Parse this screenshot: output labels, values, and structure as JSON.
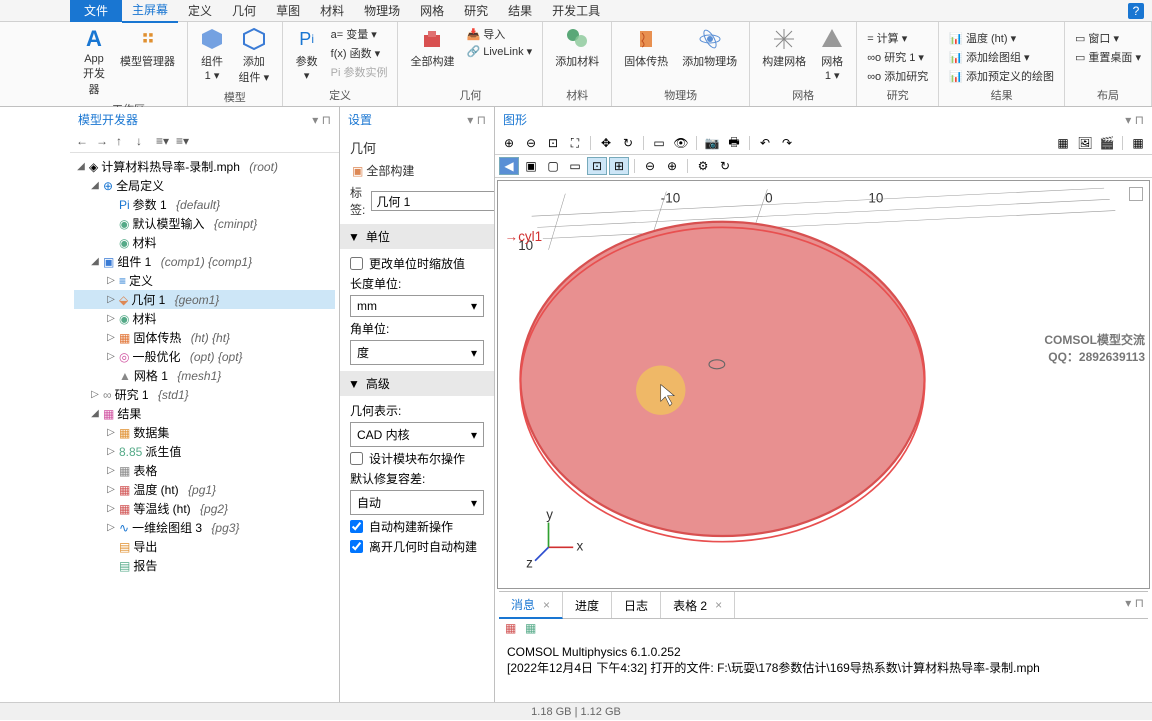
{
  "menu": {
    "file": "文件",
    "items": [
      "主屏幕",
      "定义",
      "几何",
      "草图",
      "材料",
      "物理场",
      "网格",
      "研究",
      "结果",
      "开发工具"
    ],
    "active_index": 0
  },
  "ribbon": {
    "groups": [
      {
        "label": "工作区",
        "buttons": [
          {
            "icon": "A",
            "color": "#1976d2",
            "label": "App\n开发器"
          },
          {
            "icon": "tree",
            "color": "#e09030",
            "label": "模型管理器"
          }
        ]
      },
      {
        "label": "模型",
        "buttons": [
          {
            "icon": "cube",
            "color": "#3a7bd5",
            "label": "组件 1 ▾"
          },
          {
            "icon": "diamond",
            "color": "#3a7bd5",
            "label": "添加组件 ▾"
          }
        ]
      },
      {
        "label": "定义",
        "buttons": [
          {
            "icon": "Pi",
            "color": "#1976d2",
            "label": "参数 ▾"
          }
        ],
        "small": [
          "a= 变量 ▾",
          "f(x) 函数 ▾",
          "Pi 参数实例"
        ]
      },
      {
        "label": "几何",
        "buttons": [
          {
            "icon": "geom",
            "color": "#c05050",
            "label": "全部构建"
          }
        ],
        "small": [
          "📥 导入",
          "🔗 LiveLink ▾"
        ]
      },
      {
        "label": "材料",
        "buttons": [
          {
            "icon": "mat",
            "color": "#5a8",
            "label": "添加材料"
          }
        ]
      },
      {
        "label": "物理场",
        "buttons": [
          {
            "icon": "heat",
            "color": "#e07030",
            "label": "固体传热"
          },
          {
            "icon": "phys",
            "color": "#5a8fd5",
            "label": "添加物理场"
          }
        ]
      },
      {
        "label": "网格",
        "buttons": [
          {
            "icon": "mesh",
            "color": "#888",
            "label": "构建网格"
          },
          {
            "icon": "tri",
            "color": "#888",
            "label": "网格 1 ▾"
          }
        ]
      },
      {
        "label": "研究",
        "small": [
          "= 计算 ▾",
          "∞o 研究 1 ▾",
          "∞o 添加研究"
        ]
      },
      {
        "label": "结果",
        "small": [
          "📊 温度 (ht) ▾",
          "📊 添加绘图组 ▾",
          "📊 添加预定义的绘图"
        ]
      },
      {
        "label": "布局",
        "small": [
          "▭ 窗口 ▾",
          "▭ 重置桌面 ▾"
        ]
      }
    ]
  },
  "model_tree": {
    "title": "模型开发器",
    "root": "计算材料热导率-录制.mph",
    "root_suffix": "(root)",
    "nodes": [
      {
        "icon": "globe",
        "label": "全局定义",
        "children": [
          {
            "icon": "pi",
            "label": "参数 1",
            "suffix": "{default}"
          },
          {
            "icon": "input",
            "label": "默认模型输入",
            "suffix": "{cminpt}"
          },
          {
            "icon": "mat",
            "label": "材料"
          }
        ]
      },
      {
        "icon": "cube",
        "label": "组件 1",
        "suffix": "(comp1) {comp1}",
        "children": [
          {
            "icon": "def",
            "label": "定义"
          },
          {
            "icon": "geom",
            "label": "几何 1",
            "suffix": "{geom1}",
            "selected": true
          },
          {
            "icon": "mat",
            "label": "材料"
          },
          {
            "icon": "heat",
            "label": "固体传热",
            "suffix": "(ht) {ht}"
          },
          {
            "icon": "opt",
            "label": "一般优化",
            "suffix": "(opt) {opt}"
          },
          {
            "icon": "mesh",
            "label": "网格 1",
            "suffix": "{mesh1}"
          }
        ]
      },
      {
        "icon": "study",
        "label": "研究 1",
        "suffix": "{std1}"
      },
      {
        "icon": "results",
        "label": "结果",
        "children": [
          {
            "icon": "data",
            "label": "数据集"
          },
          {
            "icon": "deriv",
            "label": "派生值"
          },
          {
            "icon": "table",
            "label": "表格"
          },
          {
            "icon": "plot",
            "label": "温度 (ht)",
            "suffix": "{pg1}"
          },
          {
            "icon": "plot",
            "label": "等温线 (ht)",
            "suffix": "{pg2}"
          },
          {
            "icon": "plot1d",
            "label": "一维绘图组 3",
            "suffix": "{pg3}"
          },
          {
            "icon": "export",
            "label": "导出"
          },
          {
            "icon": "report",
            "label": "报告"
          }
        ]
      }
    ]
  },
  "settings": {
    "title": "设置",
    "subtitle": "几何",
    "build_all": "全部构建",
    "label_lbl": "标签:",
    "label_val": "几何 1",
    "sec_unit": "单位",
    "chk_scale": "更改单位时缩放值",
    "len_lbl": "长度单位:",
    "len_val": "mm",
    "ang_lbl": "角单位:",
    "ang_val": "度",
    "sec_adv": "高级",
    "geom_repr": "几何表示:",
    "geom_repr_val": "CAD 内核",
    "chk_bool": "设计模块布尔操作",
    "repair_lbl": "默认修复容差:",
    "repair_val": "自动",
    "chk_auto_new": "自动构建新操作",
    "chk_auto_leave": "离开几何时自动构建"
  },
  "graphics": {
    "title": "图形",
    "cyl_label": "cyl1",
    "ticks": [
      "-10",
      "0",
      "10"
    ],
    "ytick": "10"
  },
  "watermark": {
    "line1": "COMSOL模型交流",
    "line2": "QQ：2892639113"
  },
  "messages": {
    "tabs": [
      "消息",
      "进度",
      "日志",
      "表格 2"
    ],
    "active": 0,
    "lines": [
      "COMSOL Multiphysics 6.1.0.252",
      "[2022年12月4日 下午4:32] 打开的文件:   F:\\玩耍\\178参数估计\\169导热系数\\计算材料热导率-录制.mph"
    ]
  },
  "status": "1.18 GB | 1.12 GB"
}
